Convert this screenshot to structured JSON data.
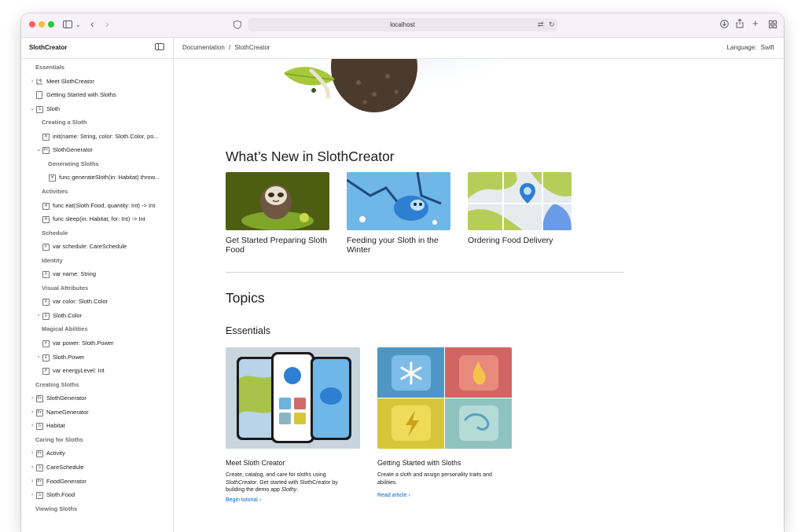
{
  "browser": {
    "url": "localhost"
  },
  "sidebar": {
    "title": "SlothCreator",
    "items": [
      {
        "kind": "section",
        "label": "Essentials",
        "indent": 0
      },
      {
        "kind": "item",
        "label": "Meet SlothCreator",
        "indent": 0,
        "chevron": "›",
        "icon": "tutorial"
      },
      {
        "kind": "item",
        "label": "Getting Started with Sloths",
        "indent": 0,
        "chevron": "",
        "icon": "doc"
      },
      {
        "kind": "item",
        "label": "Sloth",
        "indent": 0,
        "chevron": "⌄",
        "icon": "S"
      },
      {
        "kind": "section",
        "label": "Creating a Sloth",
        "indent": 1
      },
      {
        "kind": "item",
        "label": "init(name: String, color: Sloth.Color, po...",
        "indent": 1,
        "chevron": "",
        "icon": "M"
      },
      {
        "kind": "item",
        "label": "SlothGenerator",
        "indent": 1,
        "chevron": "⌄",
        "icon": "Pr"
      },
      {
        "kind": "section",
        "label": "Generating Sloths",
        "indent": 2
      },
      {
        "kind": "item",
        "label": "func generateSloth(in: Habitat) throw...",
        "indent": 2,
        "chevron": "",
        "icon": "M"
      },
      {
        "kind": "section",
        "label": "Activities",
        "indent": 1
      },
      {
        "kind": "item",
        "label": "func eat(Sloth.Food, quantity: Int) -> Int",
        "indent": 1,
        "chevron": "",
        "icon": "M"
      },
      {
        "kind": "item",
        "label": "func sleep(in: Habitat, for: Int) -> Int",
        "indent": 1,
        "chevron": "",
        "icon": "M"
      },
      {
        "kind": "section",
        "label": "Schedule",
        "indent": 1
      },
      {
        "kind": "item",
        "label": "var schedule: CareSchedule",
        "indent": 1,
        "chevron": "",
        "icon": "P"
      },
      {
        "kind": "section",
        "label": "Identity",
        "indent": 1
      },
      {
        "kind": "item",
        "label": "var name: String",
        "indent": 1,
        "chevron": "",
        "icon": "P"
      },
      {
        "kind": "section",
        "label": "Visual Attributes",
        "indent": 1
      },
      {
        "kind": "item",
        "label": "var color: Sloth.Color",
        "indent": 1,
        "chevron": "",
        "icon": "P"
      },
      {
        "kind": "item",
        "label": "Sloth.Color",
        "indent": 1,
        "chevron": "›",
        "icon": "E"
      },
      {
        "kind": "section",
        "label": "Magical Abilities",
        "indent": 1
      },
      {
        "kind": "item",
        "label": "var power: Sloth.Power",
        "indent": 1,
        "chevron": "",
        "icon": "P"
      },
      {
        "kind": "item",
        "label": "Sloth.Power",
        "indent": 1,
        "chevron": "›",
        "icon": "E"
      },
      {
        "kind": "item",
        "label": "var energyLevel: Int",
        "indent": 1,
        "chevron": "",
        "icon": "P"
      },
      {
        "kind": "section",
        "label": "Creating Sloths",
        "indent": 0
      },
      {
        "kind": "item",
        "label": "SlothGenerator",
        "indent": 0,
        "chevron": "›",
        "icon": "Pr"
      },
      {
        "kind": "item",
        "label": "NameGenerator",
        "indent": 0,
        "chevron": "›",
        "icon": "Pr"
      },
      {
        "kind": "item",
        "label": "Habitat",
        "indent": 0,
        "chevron": "›",
        "icon": "S"
      },
      {
        "kind": "section",
        "label": "Caring for Sloths",
        "indent": 0
      },
      {
        "kind": "item",
        "label": "Activity",
        "indent": 0,
        "chevron": "›",
        "icon": "Pr"
      },
      {
        "kind": "item",
        "label": "CareSchedule",
        "indent": 0,
        "chevron": "›",
        "icon": "S"
      },
      {
        "kind": "item",
        "label": "FoodGenerator",
        "indent": 0,
        "chevron": "›",
        "icon": "Pr"
      },
      {
        "kind": "item",
        "label": "Sloth.Food",
        "indent": 0,
        "chevron": "›",
        "icon": "S"
      },
      {
        "kind": "section",
        "label": "Viewing Sloths",
        "indent": 0
      }
    ]
  },
  "header": {
    "breadcrumb": [
      "Documentation",
      "SlothCreator"
    ],
    "breadcrumb_separator": "/",
    "language_label": "Language:",
    "language_value": "Swift"
  },
  "main": {
    "whats_new_title": "What’s New in SlothCreator",
    "whats_new_cards": [
      {
        "title": "Get Started Preparing Sloth Food"
      },
      {
        "title": "Feeding your Sloth in the Winter"
      },
      {
        "title": "Ordering Food Delivery"
      }
    ],
    "topics_title": "Topics",
    "essentials_title": "Essentials",
    "topic_cards": [
      {
        "title": "Meet Sloth Creator",
        "description_parts": [
          "Create, catalog, and care for sloths using ",
          "SlothCreator",
          ". Get started with SlothCreator by building the demo app ",
          "Slothy",
          "."
        ],
        "link": "Begin tutorial",
        "link_chevron": "›"
      },
      {
        "title": "Getting Started with Sloths",
        "description": "Create a sloth and assign personality traits and abilities.",
        "link": "Read article",
        "link_chevron": "›"
      }
    ]
  }
}
